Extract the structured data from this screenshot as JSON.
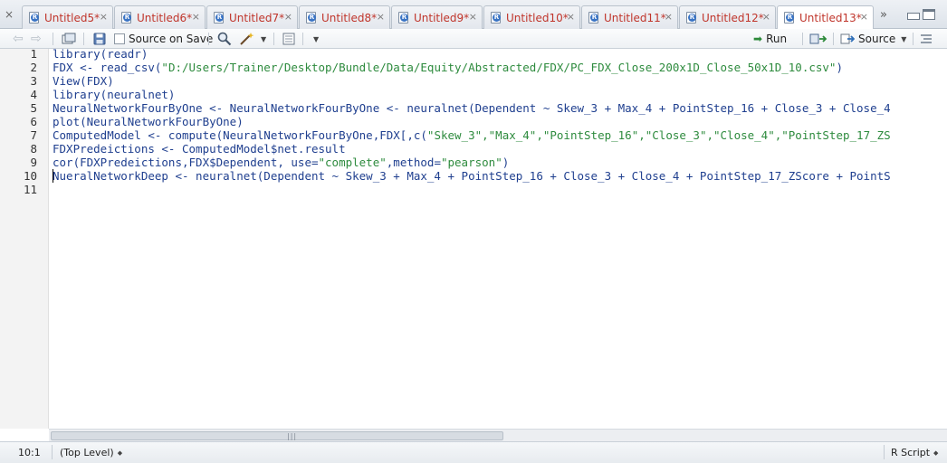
{
  "tabs": [
    {
      "label": "Untitled5*"
    },
    {
      "label": "Untitled6*"
    },
    {
      "label": "Untitled7*"
    },
    {
      "label": "Untitled8*"
    },
    {
      "label": "Untitled9*"
    },
    {
      "label": "Untitled10*"
    },
    {
      "label": "Untitled11*"
    },
    {
      "label": "Untitled12*"
    },
    {
      "label": "Untitled13*"
    }
  ],
  "tab_close_glyph": "×",
  "tab_overflow": "»",
  "toolbar": {
    "source_on_save": "Source on Save",
    "run": "Run",
    "source": "Source"
  },
  "editor": {
    "line_numbers": [
      "1",
      "2",
      "3",
      "4",
      "5",
      "6",
      "7",
      "8",
      "9",
      "10",
      "11"
    ],
    "lines": [
      {
        "a": "library(readr)",
        "s": "",
        "b": ""
      },
      {
        "a": "FDX <- read_csv(",
        "s": "\"D:/Users/Trainer/Desktop/Bundle/Data/Equity/Abstracted/FDX/PC_FDX_Close_200x1D_Close_50x1D_10.csv\"",
        "b": ")"
      },
      {
        "a": "View(FDX)",
        "s": "",
        "b": ""
      },
      {
        "a": "library(neuralnet)",
        "s": "",
        "b": ""
      },
      {
        "a": "NeuralNetworkFourByOne <- NeuralNetworkFourByOne <- neuralnet(Dependent ~ Skew_3 + Max_4 + PointStep_16 + Close_3 + Close_4",
        "s": "",
        "b": ""
      },
      {
        "a": "plot(NeuralNetworkFourByOne)",
        "s": "",
        "b": ""
      },
      {
        "a": "ComputedModel <- compute(NeuralNetworkFourByOne,FDX[,c(",
        "s": "\"Skew_3\",\"Max_4\",\"PointStep_16\",\"Close_3\",\"Close_4\",\"PointStep_17_ZS",
        "b": ""
      },
      {
        "a": "FDXPredeictions <- ComputedModel$net.result",
        "s": "",
        "b": ""
      },
      {
        "a": "cor(FDXPredeictions,FDX$Dependent, use=",
        "s": "\"complete\"",
        "b": ",method=",
        "s2": "\"pearson\"",
        "c": ")"
      },
      {
        "a": "NueralNetworkDeep <- neuralnet(Dependent ~ Skew_3 + Max_4 + PointStep_16 + Close_3 + Close_4 + PointStep_17_ZScore + PointS",
        "s": "",
        "b": ""
      },
      {
        "a": "",
        "s": "",
        "b": ""
      }
    ]
  },
  "status": {
    "position": "10:1",
    "scope": "(Top Level)",
    "language": "R Script"
  }
}
